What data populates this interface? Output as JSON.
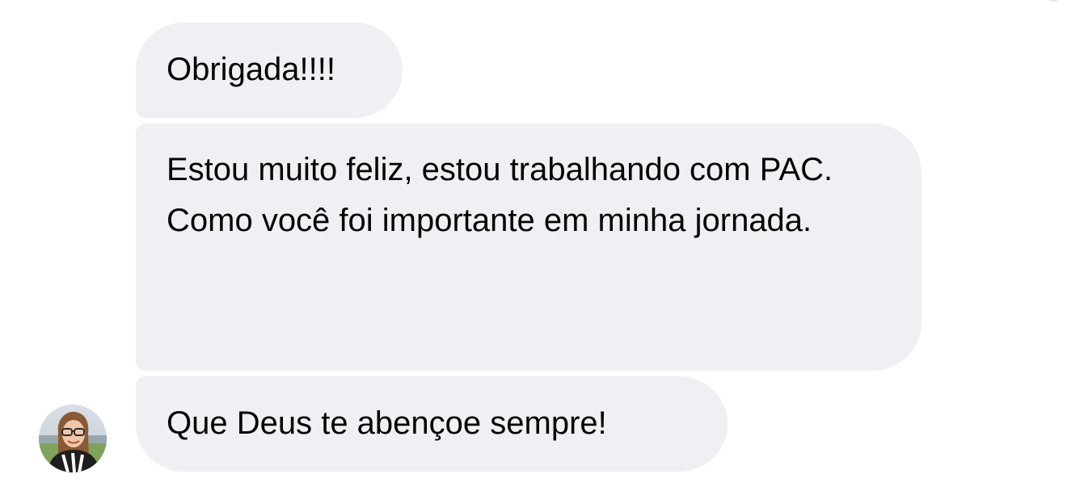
{
  "conversation": {
    "messages": [
      {
        "paragraphs": [
          "Obrigada!!!!"
        ]
      },
      {
        "paragraphs": [
          "Estou muito feliz, estou trabalhando com PAC.",
          "Como você foi importante em minha jornada."
        ]
      },
      {
        "paragraphs": [
          "Que Deus te abençoe sempre!"
        ]
      }
    ],
    "sender_avatar_icon": "profile-photo-avatar",
    "bubble_color": "#efeff4",
    "text_color": "#050505"
  }
}
